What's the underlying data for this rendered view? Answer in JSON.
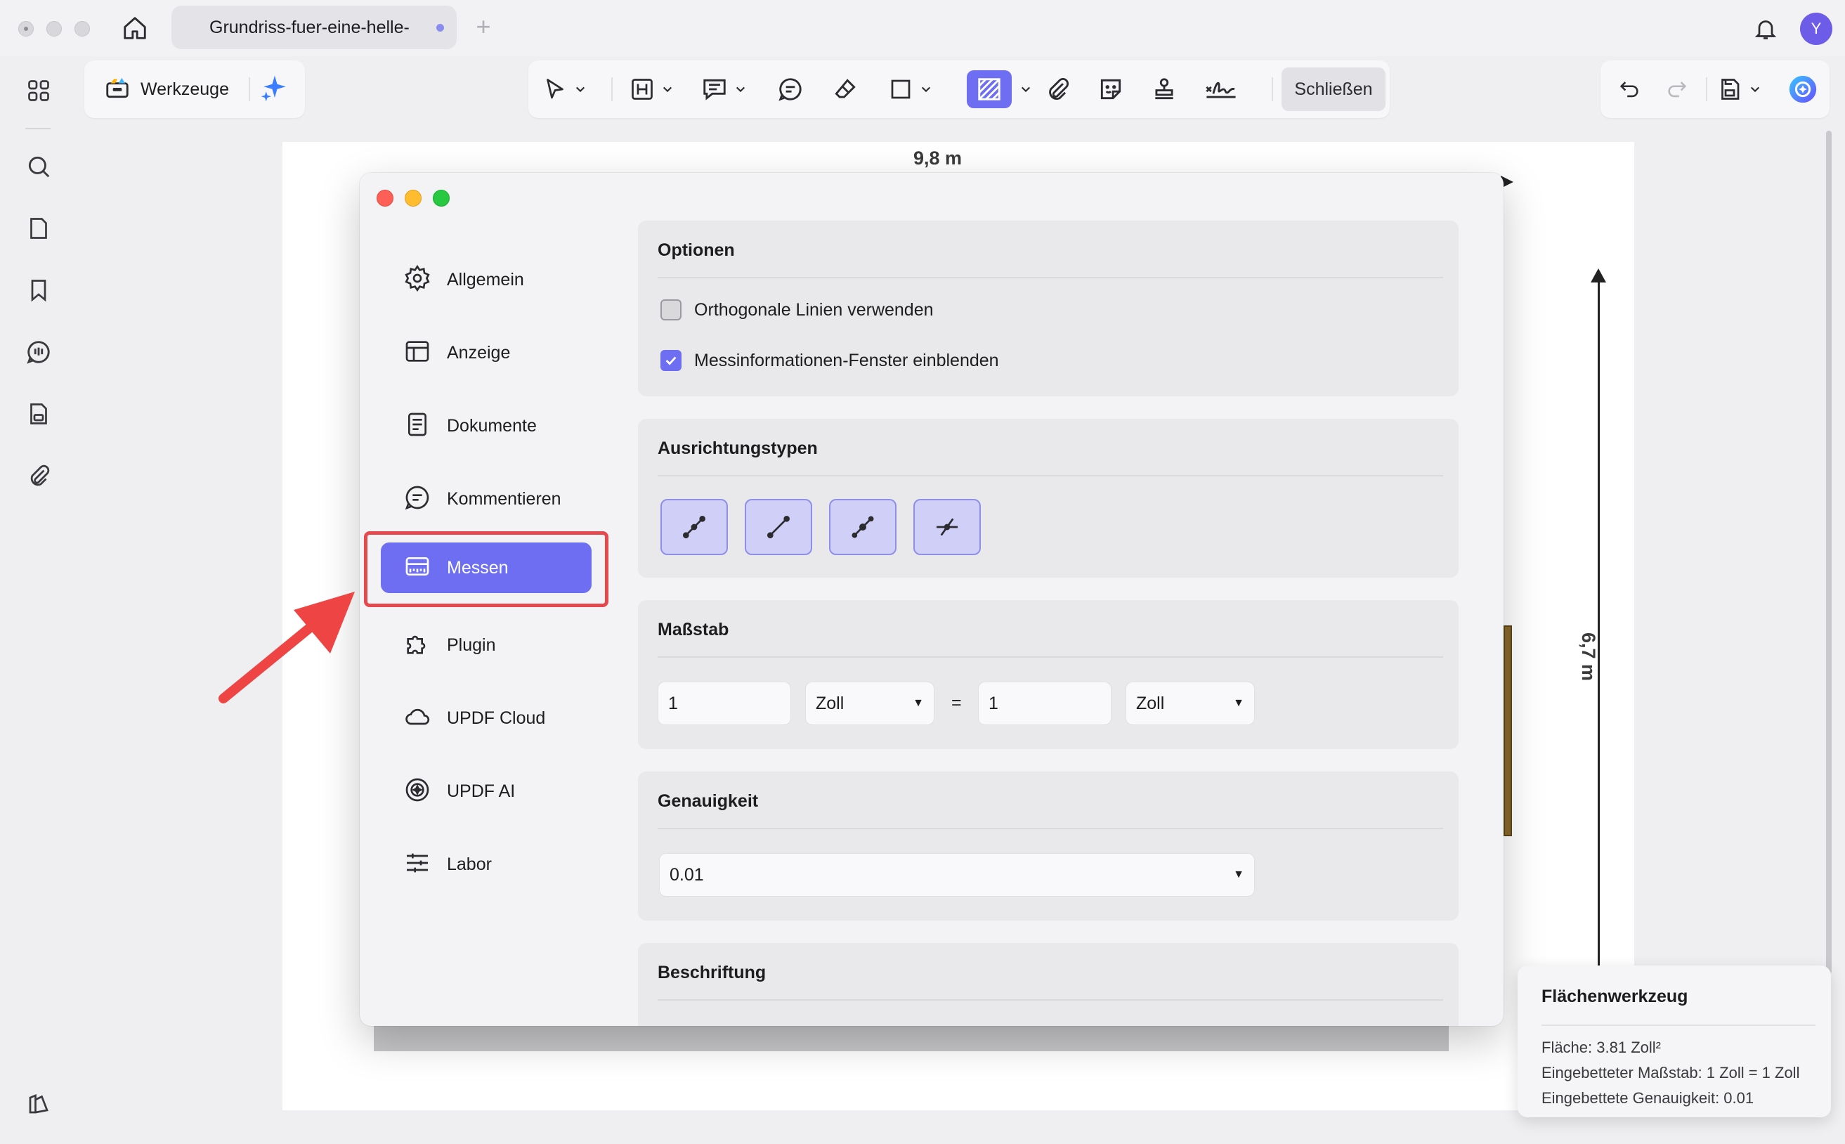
{
  "titlebar": {
    "tab_title": "Grundriss-fuer-eine-helle-",
    "avatar_initial": "Y"
  },
  "toolbar": {
    "tools_label": "Werkzeuge",
    "close_label": "Schließen",
    "accent_color": "#6e6ef2"
  },
  "document": {
    "dimension_top": "9,8 m",
    "dimension_right": "6,7 m"
  },
  "dialog": {
    "nav": [
      {
        "label": "Allgemein",
        "icon": "gear-icon"
      },
      {
        "label": "Anzeige",
        "icon": "layout-icon"
      },
      {
        "label": "Dokumente",
        "icon": "document-icon"
      },
      {
        "label": "Kommentieren",
        "icon": "comment-icon"
      },
      {
        "label": "Messen",
        "icon": "ruler-icon",
        "active": true
      },
      {
        "label": "Plugin",
        "icon": "puzzle-icon"
      },
      {
        "label": "UPDF Cloud",
        "icon": "cloud-icon"
      },
      {
        "label": "UPDF AI",
        "icon": "ai-icon"
      },
      {
        "label": "Labor",
        "icon": "sliders-icon"
      }
    ],
    "options": {
      "title": "Optionen",
      "orthogonal_label": "Orthogonale Linien verwenden",
      "orthogonal_checked": false,
      "show_info_label": "Messinformationen-Fenster einblenden",
      "show_info_checked": true
    },
    "alignment": {
      "title": "Ausrichtungstypen"
    },
    "scale": {
      "title": "Maßstab",
      "left_value": "1",
      "left_unit": "Zoll",
      "equals": "=",
      "right_value": "1",
      "right_unit": "Zoll"
    },
    "precision": {
      "title": "Genauigkeit",
      "value": "0.01"
    },
    "labeling": {
      "title": "Beschriftung"
    }
  },
  "info_panel": {
    "title": "Flächenwerkzeug",
    "area": "Fläche: 3.81 Zoll²",
    "scale": "Eingebetteter Maßstab: 1 Zoll = 1 Zoll",
    "precision": "Eingebettete Genauigkeit: 0.01"
  }
}
